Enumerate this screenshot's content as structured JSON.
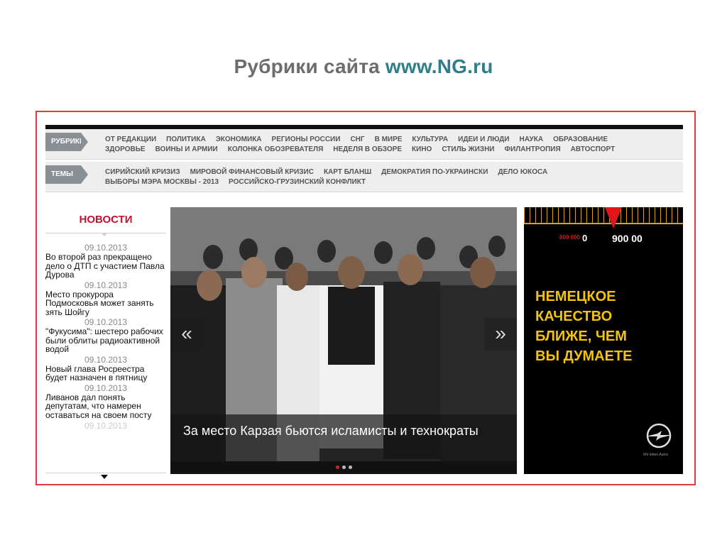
{
  "slide": {
    "title_prefix": "Рубрики сайта",
    "title_url": "www.NG.ru"
  },
  "nav": {
    "rubrics_label": "РУБРИКИ",
    "rubrics_line1": [
      "ОТ РЕДАКЦИИ",
      "ПОЛИТИКА",
      "ЭКОНОМИКА",
      "РЕГИОНЫ РОССИИ",
      "СНГ",
      "В МИРЕ",
      "КУЛЬТУРА",
      "ИДЕИ И ЛЮДИ",
      "НАУКА",
      "ОБРАЗОВАНИЕ"
    ],
    "rubrics_line2": [
      "ЗДОРОВЬЕ",
      "ВОИНЫ И АРМИИ",
      "КОЛОНКА ОБОЗРЕВАТЕЛЯ",
      "НЕДЕЛЯ В ОБЗОРЕ",
      "КИНО",
      "СТИЛЬ ЖИЗНИ",
      "ФИЛАНТРОПИЯ",
      "АВТОСПОРТ"
    ],
    "themes_label": "ТЕМЫ",
    "themes_line1": [
      "СИРИЙСКИЙ КРИЗИЗ",
      "МИРОВОЙ ФИНАНСОВЫЙ КРИЗИС",
      "КАРТ БЛАНШ",
      "ДЕМОКРАТИЯ ПО-УКРАИНСКИ",
      "ДЕЛО ЮКОСА"
    ],
    "themes_line2": [
      "ВЫБОРЫ МЭРА МОСКВЫ - 2013",
      "РОССИЙСКО-ГРУЗИНСКИЙ КОНФЛИКТ"
    ]
  },
  "news": {
    "heading": "НОВОСТИ",
    "items": [
      {
        "date": "09.10.2013",
        "text": "Во второй раз прекращено дело о ДТП с участием Павла Дурова"
      },
      {
        "date": "09.10.2013",
        "text": "Место прокурора Подмосковья может занять зять Шойгу"
      },
      {
        "date": "09.10.2013",
        "text": "\"Фукусима\": шестеро рабочих были облиты радиоактивной водой"
      },
      {
        "date": "09.10.2013",
        "text": "Новый глава Росреестра будет назначен в пятницу"
      },
      {
        "date": "09.10.2013",
        "text": "Ливанов дал понять депутатам, что намерен оставаться на своем посту"
      }
    ],
    "faded_date": "09.10.2013"
  },
  "hero": {
    "caption": "За место Карзая бьются исламисты и технократы",
    "prev_glyph": "«",
    "next_glyph": "»",
    "dots": 3,
    "active_dot": 0
  },
  "ad": {
    "num_red": "800 000",
    "num_left": "0",
    "num_right": "900 00",
    "text_lines": [
      "НЕМЕЦКОЕ",
      "КАЧЕСТВО",
      "БЛИЖЕ, ЧЕМ",
      "ВЫ ДУМАЕТЕ"
    ],
    "slogan": "Wir leben Autos",
    "colors": {
      "yellow": "#f2c40a",
      "red": "#e0161b"
    }
  }
}
